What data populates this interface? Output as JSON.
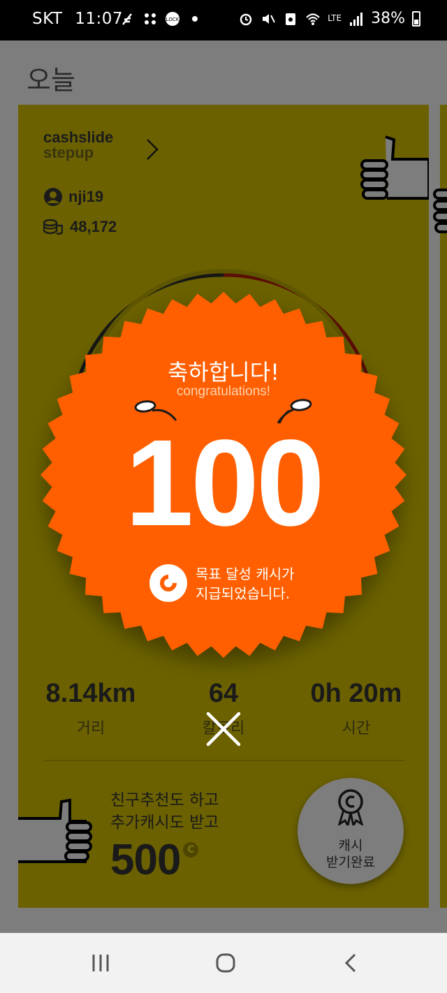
{
  "status_bar": {
    "carrier": "SKT",
    "time": "11:07",
    "network": "LTE",
    "battery": "38%"
  },
  "app": {
    "page_title": "오늘"
  },
  "card": {
    "brand_line1": "cashslide",
    "brand_line2": "stepup",
    "username": "nji19",
    "cash_balance": "48,172",
    "stats": [
      {
        "value": "8.14km",
        "label": "거리"
      },
      {
        "value": "64",
        "label": "칼로리"
      },
      {
        "value": "0h 20m",
        "label": "시간"
      }
    ],
    "promo": {
      "line1": "친구추천도 하고",
      "line2": "추가캐시도 받고",
      "amount": "500",
      "currency_symbol": "C"
    },
    "claim_button": {
      "line1": "캐시",
      "line2": "받기완료"
    }
  },
  "popup": {
    "title_ko": "축하합니다!",
    "title_en": "congratulations!",
    "amount": "100",
    "message_line1": "목표 달성 캐시가",
    "message_line2": "지급되었습니다."
  },
  "colors": {
    "badge_orange": "#ff5e00",
    "card_dimmed": "#6b6100",
    "overlay_gray": "#7d7d7d"
  },
  "icons": [
    "user-icon",
    "coins-icon",
    "chevron-right-icon",
    "thumbs-up-icon",
    "medal-icon",
    "close-icon",
    "nav-recents-icon",
    "nav-home-icon",
    "nav-back-icon"
  ]
}
